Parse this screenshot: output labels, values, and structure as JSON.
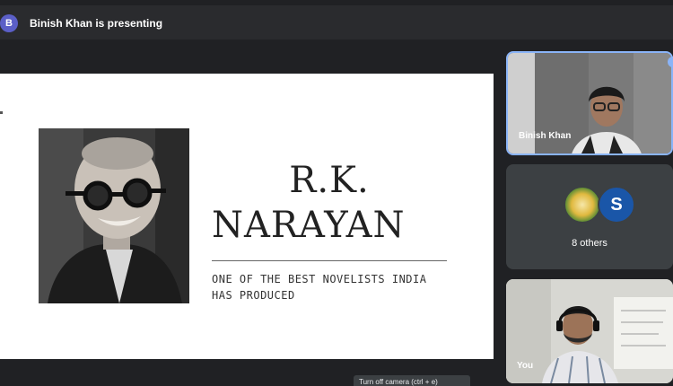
{
  "header": {
    "presenter_initial": "B",
    "presenting_text": "Binish Khan is presenting"
  },
  "slide": {
    "title_line1": "R.K.",
    "title_line2": "NARAYAN",
    "subtitle": "ONE OF THE BEST NOVELISTS INDIA HAS PRODUCED"
  },
  "participants": {
    "binish": {
      "name": "Binish Khan"
    },
    "others": {
      "initial": "S",
      "label": "8 others"
    },
    "you": {
      "name": "You"
    }
  },
  "tooltip": {
    "text": "Turn off camera (ctrl + e)"
  },
  "colors": {
    "background": "#202124",
    "active_border": "#8ab4f8",
    "avatar_purple": "#5b5fc7",
    "avatar_blue": "#1a56a8"
  }
}
